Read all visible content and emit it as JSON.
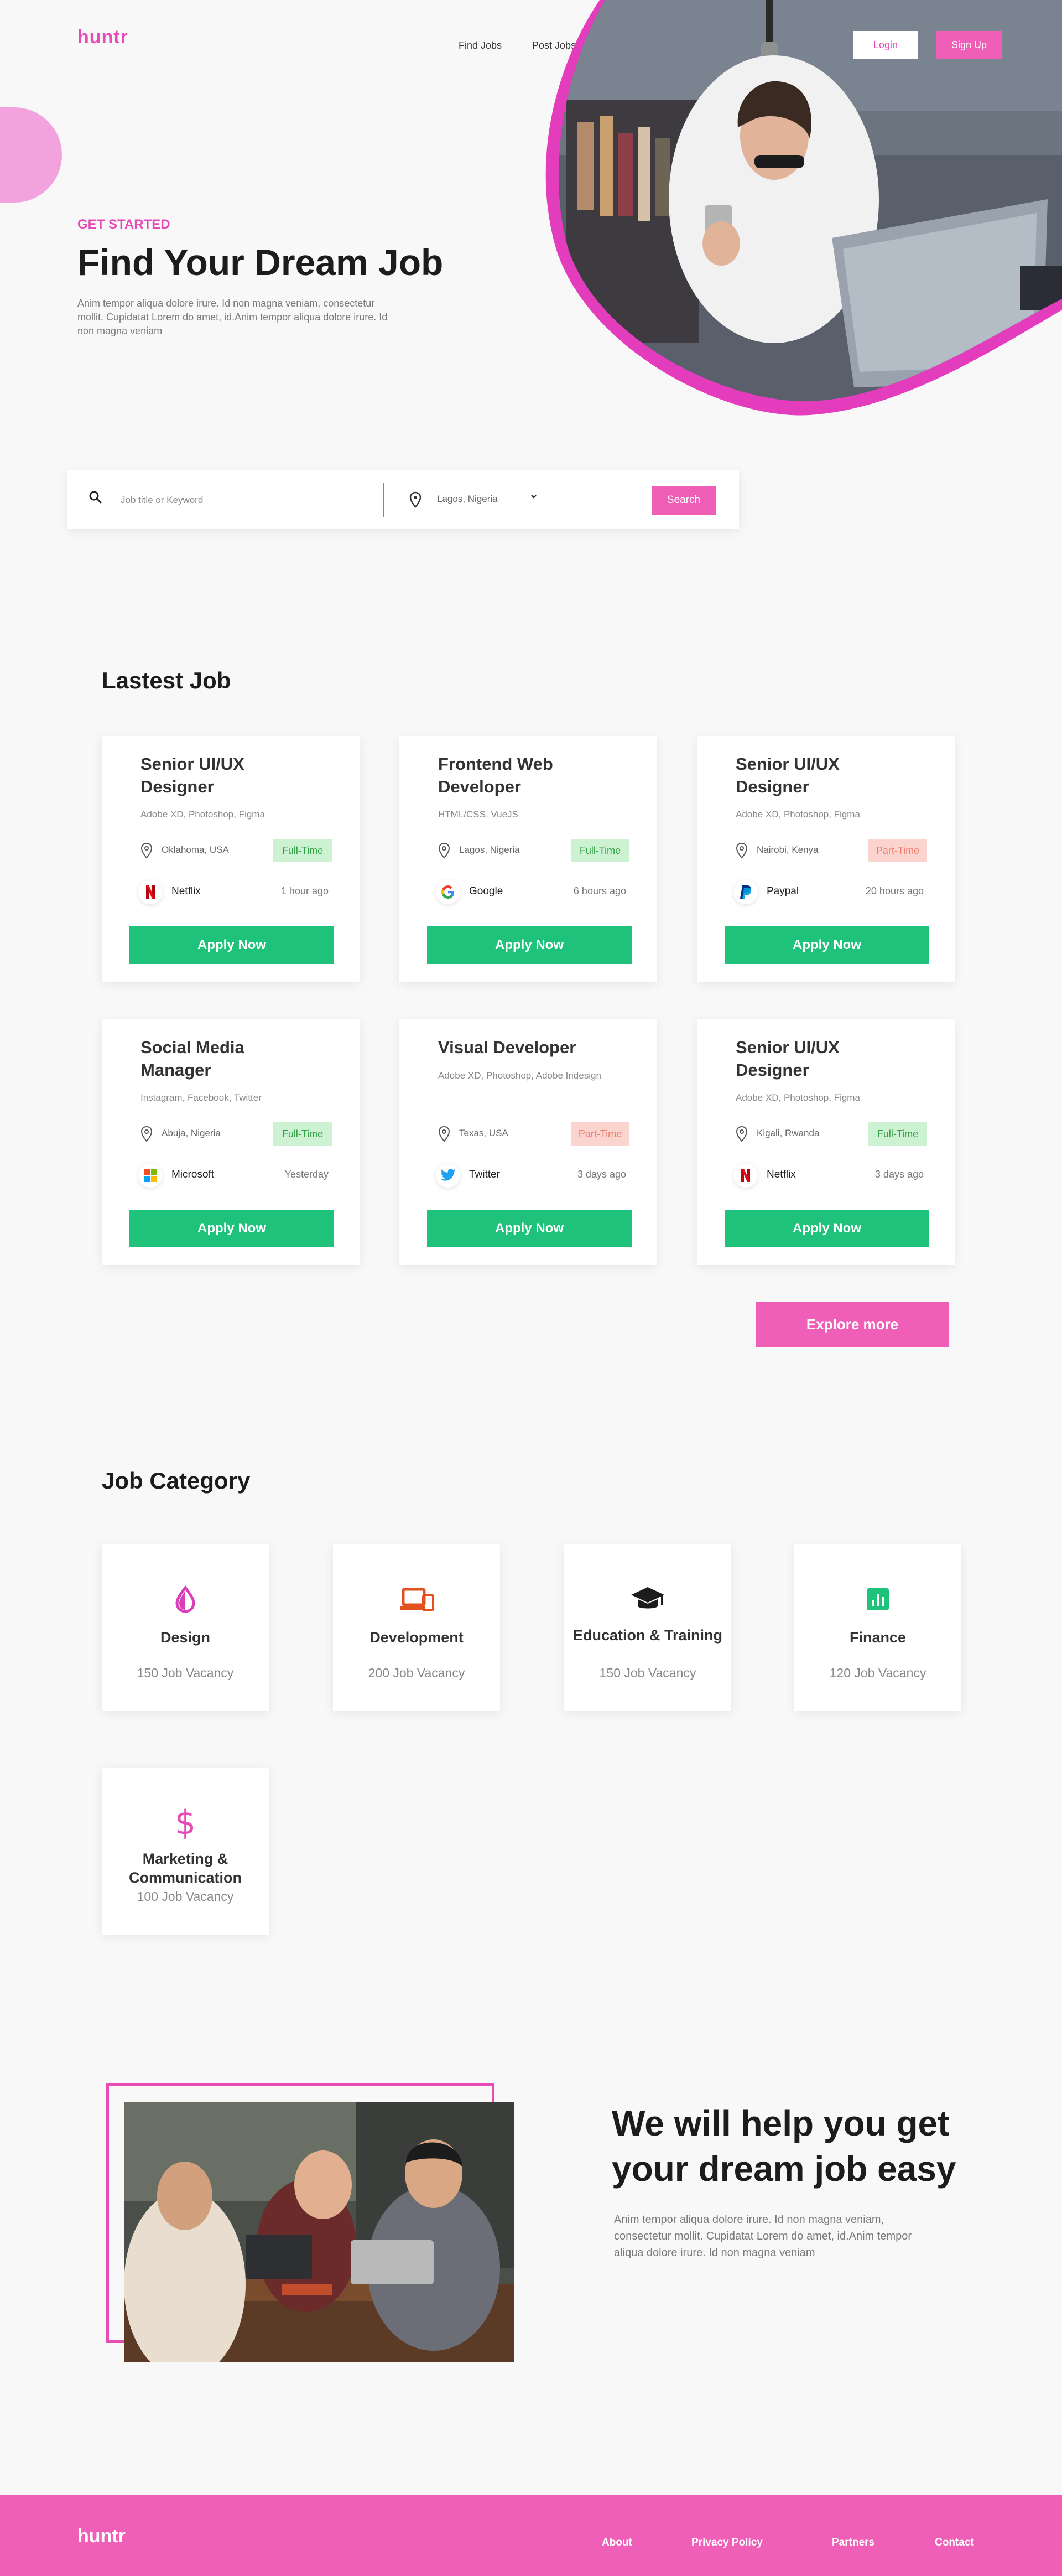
{
  "header": {
    "logo": "huntr",
    "nav": [
      "Find Jobs",
      "Post Jobs"
    ],
    "login_label": "Login",
    "signup_label": "Sign Up"
  },
  "hero": {
    "kicker": "GET STARTED",
    "title": "Find Your Dream Job",
    "text": "Anim tempor aliqua dolore irure. Id non magna veniam, consectetur mollit. Cupidatat Lorem do amet, id.Anim tempor aliqua dolore irure. Id non magna veniam"
  },
  "search": {
    "placeholder": "Job title or Keyword",
    "location": "Lagos, Nigeria",
    "button_label": "Search"
  },
  "latest_jobs": {
    "title": "Lastest Job",
    "apply_label": "Apply Now",
    "explore_label": "Explore more",
    "jobs": [
      {
        "title": "Senior UI/UX Designer",
        "skills": "Adobe XD, Photoshop, Figma",
        "location": "Oklahoma, USA",
        "type": "Full-Time",
        "company": "Netflix",
        "time": "1 hour ago",
        "logo": "netflix-icon"
      },
      {
        "title": "Frontend Web Developer",
        "skills": "HTML/CSS, VueJS",
        "location": "Lagos, Nigeria",
        "type": "Full-Time",
        "company": "Google",
        "time": "6 hours ago",
        "logo": "google-icon"
      },
      {
        "title": "Senior UI/UX Designer",
        "skills": "Adobe XD, Photoshop, Figma",
        "location": "Nairobi, Kenya",
        "type": "Part-Time",
        "company": "Paypal",
        "time": "20 hours ago",
        "logo": "paypal-icon"
      },
      {
        "title": "Social Media Manager",
        "skills": "Instagram, Facebook, Twitter",
        "location": "Abuja, Nigeria",
        "type": "Full-Time",
        "company": "Microsoft",
        "time": "Yesterday",
        "logo": "microsoft-icon"
      },
      {
        "title": "Visual Developer",
        "skills": "Adobe XD, Photoshop, Adobe Indesign",
        "location": "Texas, USA",
        "type": "Part-Time",
        "company": "Twitter",
        "time": "3 days ago",
        "logo": "twitter-icon"
      },
      {
        "title": "Senior UI/UX Designer",
        "skills": "Adobe XD, Photoshop, Figma",
        "location": "Kigali, Rwanda",
        "type": "Full-Time",
        "company": "Netflix",
        "time": "3 days ago",
        "logo": "netflix-icon"
      }
    ]
  },
  "categories": {
    "title": "Job Category",
    "items": [
      {
        "name": "Design",
        "count": "150 Job Vacancy",
        "icon": "design-drop-icon"
      },
      {
        "name": "Development",
        "count": "200 Job Vacancy",
        "icon": "laptop-icon"
      },
      {
        "name": "Education & Training",
        "count": "150 Job Vacancy",
        "icon": "graduation-cap-icon"
      },
      {
        "name": "Finance",
        "count": "120 Job Vacancy",
        "icon": "chart-icon"
      },
      {
        "name": "Marketing & Communication",
        "count": "100 Job Vacancy",
        "icon": "dollar-icon"
      }
    ]
  },
  "help": {
    "title": "We will help you get your dream job easy",
    "text": "Anim tempor aliqua dolore irure. Id non magna veniam, consectetur mollit. Cupidatat Lorem do amet, id.Anim tempor aliqua dolore irure. Id non magna veniam"
  },
  "footer": {
    "logo": "huntr",
    "links": [
      "About",
      "Privacy Policy",
      "Partners",
      "Contact"
    ]
  },
  "colors": {
    "brand": "#ef5fb7",
    "accent_pink": "#e64bb8",
    "apply_green": "#1ec27b",
    "full_time_bg": "#cdf2d1",
    "part_time_bg": "#fbd4cf"
  }
}
